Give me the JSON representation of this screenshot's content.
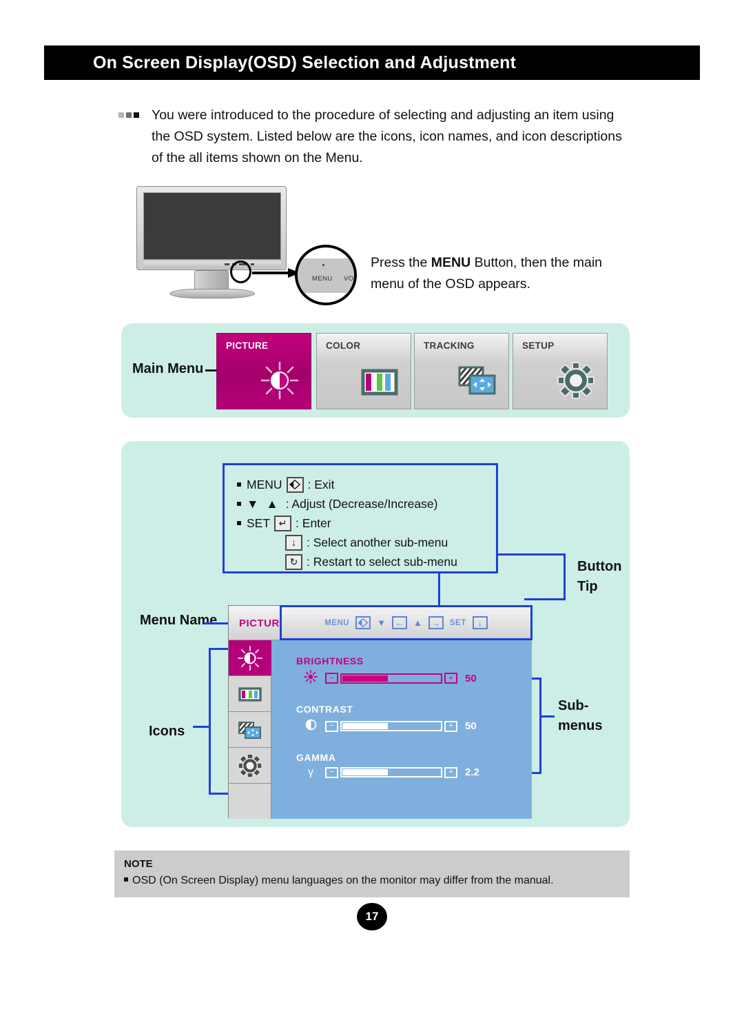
{
  "header": {
    "title": "On Screen Display(OSD) Selection and Adjustment"
  },
  "intro": {
    "text": "You were introduced to the procedure of selecting and adjusting an item using the OSD system. Listed below are the icons, icon names, and icon descriptions of the all items shown on the Menu."
  },
  "callout": {
    "menu_label": "MENU",
    "vol_label": "VO",
    "instruction_before": "Press the ",
    "instruction_bold": "MENU",
    "instruction_after": " Button, then the main menu of the OSD appears."
  },
  "main_menu": {
    "label": "Main Menu",
    "tabs": [
      {
        "label": "PICTURE",
        "icon": "brightness-icon",
        "active": true
      },
      {
        "label": "COLOR",
        "icon": "color-bars-icon",
        "active": false
      },
      {
        "label": "TRACKING",
        "icon": "tracking-icon",
        "active": false
      },
      {
        "label": "SETUP",
        "icon": "gear-icon",
        "active": false
      }
    ]
  },
  "button_tip": {
    "label": "Button Tip",
    "items": [
      {
        "prefix": "MENU",
        "key": "exit-icon",
        "desc": ": Exit",
        "indent": false,
        "bullet": true
      },
      {
        "prefix": "",
        "key": "down-up-arrows",
        "desc": ": Adjust (Decrease/Increase)",
        "indent": false,
        "bullet": true
      },
      {
        "prefix": "SET",
        "key": "enter-icon",
        "desc": ": Enter",
        "indent": false,
        "bullet": true
      },
      {
        "prefix": "",
        "key": "down-arrow-icon",
        "desc": ": Select another sub-menu",
        "indent": true,
        "bullet": false
      },
      {
        "prefix": "",
        "key": "restart-icon",
        "desc": ": Restart to select sub-menu",
        "indent": true,
        "bullet": false
      }
    ]
  },
  "osd": {
    "menu_name_label": "Menu Name",
    "icons_label": "Icons",
    "submenus_label": "Sub-\nmenus",
    "submenus_label_line1": "Sub-",
    "submenus_label_line2": "menus",
    "title": "PICTURE",
    "tip_strip": {
      "menu_text": "MENU",
      "set_text": "SET",
      "exit_icon": "exit-icon",
      "down_arrow": "▼",
      "left_key": "←",
      "up_arrow": "▲",
      "right_key": "→",
      "select_key": "↓"
    },
    "sidebar_icons": [
      "brightness-icon",
      "color-bars-icon",
      "tracking-icon",
      "gear-icon"
    ],
    "rows": [
      {
        "name": "BRIGHTNESS",
        "glyph": "sun-icon",
        "value": "50",
        "fill_pct": 46,
        "active": true
      },
      {
        "name": "CONTRAST",
        "glyph": "half-moon-icon",
        "value": "50",
        "fill_pct": 46,
        "active": false
      },
      {
        "name": "GAMMA",
        "glyph": "γ",
        "value": "2.2",
        "fill_pct": 46,
        "active": false
      }
    ]
  },
  "note": {
    "title": "NOTE",
    "text": "OSD (On Screen Display) menu languages on the monitor may differ from the manual."
  },
  "page": {
    "number": "17"
  },
  "colors": {
    "accent_magenta": "#c4007d",
    "panel_mint": "#cdeee6",
    "connector_blue": "#1f3fd8",
    "osd_body_blue": "#7fafdd"
  }
}
